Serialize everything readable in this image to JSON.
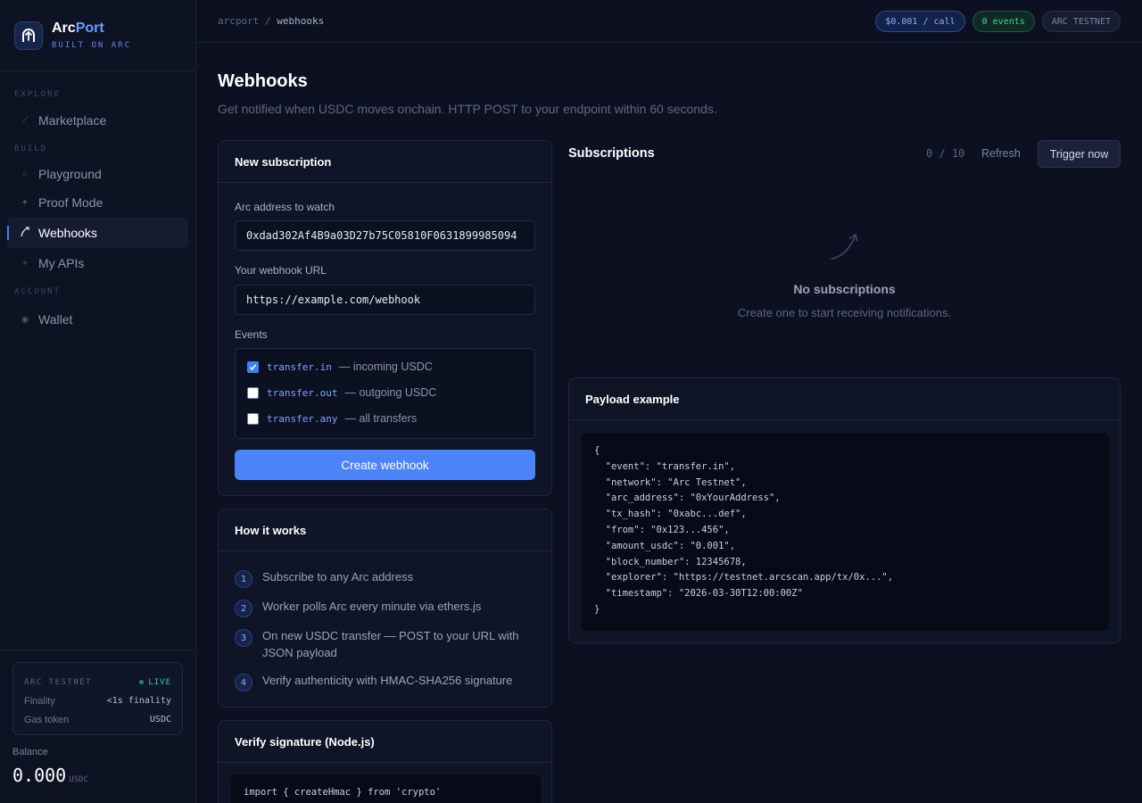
{
  "brand": {
    "name_primary": "Arc",
    "name_accent": "Port",
    "subtitle": "BUILT ON ARC"
  },
  "nav": {
    "sections": {
      "explore": "EXPLORE",
      "build": "BUILD",
      "account": "ACCOUNT"
    },
    "items": [
      {
        "label": "Marketplace",
        "icon": "sparkle-icon"
      },
      {
        "label": "Playground",
        "icon": "circle-icon"
      },
      {
        "label": "Proof Mode",
        "icon": "diamond-icon"
      },
      {
        "label": "Webhooks",
        "icon": "arrow-curve-icon",
        "active": true
      },
      {
        "label": "My APIs",
        "icon": "plus-icon"
      },
      {
        "label": "Wallet",
        "icon": "wallet-dot-icon"
      }
    ]
  },
  "network_card": {
    "title": "ARC TESTNET",
    "status": "LIVE",
    "finality_label": "Finality",
    "finality_value": "<1s finality",
    "gas_label": "Gas token",
    "gas_value": "USDC"
  },
  "balance": {
    "label": "Balance",
    "value": "0.000",
    "unit": "USDC"
  },
  "topbar": {
    "breadcrumb_root": "arcport",
    "breadcrumb_sep": "/",
    "breadcrumb_current": "webhooks",
    "badge_price": "$0.001 / call",
    "badge_events": "0 events",
    "badge_network": "ARC TESTNET"
  },
  "page": {
    "title": "Webhooks",
    "subtitle": "Get notified when USDC moves onchain. HTTP POST to your endpoint within 60 seconds."
  },
  "new_subscription": {
    "title": "New subscription",
    "address_label": "Arc address to watch",
    "address_value": "0xdad302Af4B9a03D27b75C05810F0631899985094",
    "url_label": "Your webhook URL",
    "url_value": "https://example.com/webhook",
    "events_label": "Events",
    "events": [
      {
        "code": "transfer.in",
        "desc": "— incoming USDC",
        "checked": true
      },
      {
        "code": "transfer.out",
        "desc": "— outgoing USDC",
        "checked": false
      },
      {
        "code": "transfer.any",
        "desc": "— all transfers",
        "checked": false
      }
    ],
    "create_label": "Create webhook"
  },
  "how_it_works": {
    "title": "How it works",
    "steps": [
      {
        "num": "1",
        "text": "Subscribe to any Arc address"
      },
      {
        "num": "2",
        "text": "Worker polls Arc every minute via ethers.js"
      },
      {
        "num": "3",
        "text": "On new USDC transfer — POST to your URL with JSON payload"
      },
      {
        "num": "4",
        "text": "Verify authenticity with HMAC-SHA256 signature"
      }
    ]
  },
  "verify": {
    "title": "Verify signature (Node.js)",
    "code_first_line": "import { createHmac } from 'crypto'"
  },
  "subscriptions": {
    "title": "Subscriptions",
    "count": "0 / 10",
    "refresh_label": "Refresh",
    "trigger_label": "Trigger now",
    "empty_title": "No subscriptions",
    "empty_sub": "Create one to start receiving notifications."
  },
  "payload": {
    "title": "Payload example",
    "code": "{\n  \"event\": \"transfer.in\",\n  \"network\": \"Arc Testnet\",\n  \"arc_address\": \"0xYourAddress\",\n  \"tx_hash\": \"0xabc...def\",\n  \"from\": \"0x123...456\",\n  \"amount_usdc\": \"0.001\",\n  \"block_number\": 12345678,\n  \"explorer\": \"https://testnet.arcscan.app/tx/0x...\",\n  \"timestamp\": \"2026-03-30T12:00:00Z\"\n}"
  },
  "colors": {
    "accent": "#4b83f8",
    "live": "#3fcf8e",
    "background": "#0c1020"
  }
}
